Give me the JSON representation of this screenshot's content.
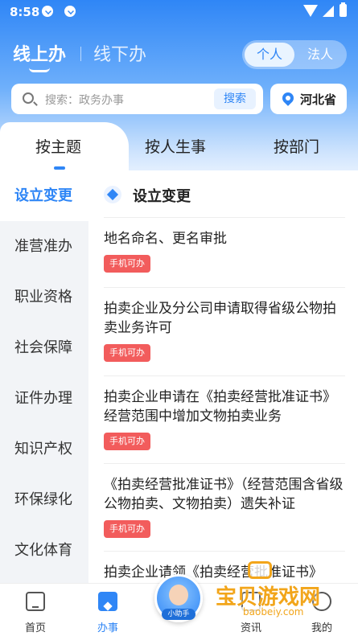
{
  "status_bar": {
    "time": "8:58"
  },
  "header": {
    "mode_online": "线上办",
    "mode_offline": "线下办",
    "toggle_personal": "个人",
    "toggle_legal": "法人"
  },
  "search": {
    "placeholder": "搜索：政务办事",
    "button": "搜索",
    "region": "河北省"
  },
  "category_tabs": [
    "按主题",
    "按人生事",
    "按部门"
  ],
  "sidebar": {
    "items": [
      "设立变更",
      "准营准办",
      "职业资格",
      "社会保障",
      "证件办理",
      "知识产权",
      "环保绿化",
      "文化体育"
    ]
  },
  "list": {
    "section_title": "设立变更",
    "items": [
      {
        "title": "地名命名、更名审批",
        "badge": "手机可办"
      },
      {
        "title": "拍卖企业及分公司申请取得省级公物拍卖业务许可",
        "badge": "手机可办"
      },
      {
        "title": "拍卖企业申请在《拍卖经营批准证书》经营范围中增加文物拍卖业务",
        "badge": "手机可办"
      },
      {
        "title": "《拍卖经营批准证书》（经营范围含省级公物拍卖、文物拍卖）遗失补证",
        "badge": "手机可办"
      },
      {
        "title": "拍卖企业请领《拍卖经营批准证书》",
        "badge": ""
      }
    ]
  },
  "bottom_nav": {
    "home": "首页",
    "work": "办事",
    "assistant": "小助手",
    "news": "资讯",
    "me": "我的"
  },
  "watermark": {
    "text": "宝贝游戏网",
    "url": "baobeiy.com"
  },
  "colors": {
    "accent": "#2f86f6",
    "badge": "#f25c5c"
  }
}
